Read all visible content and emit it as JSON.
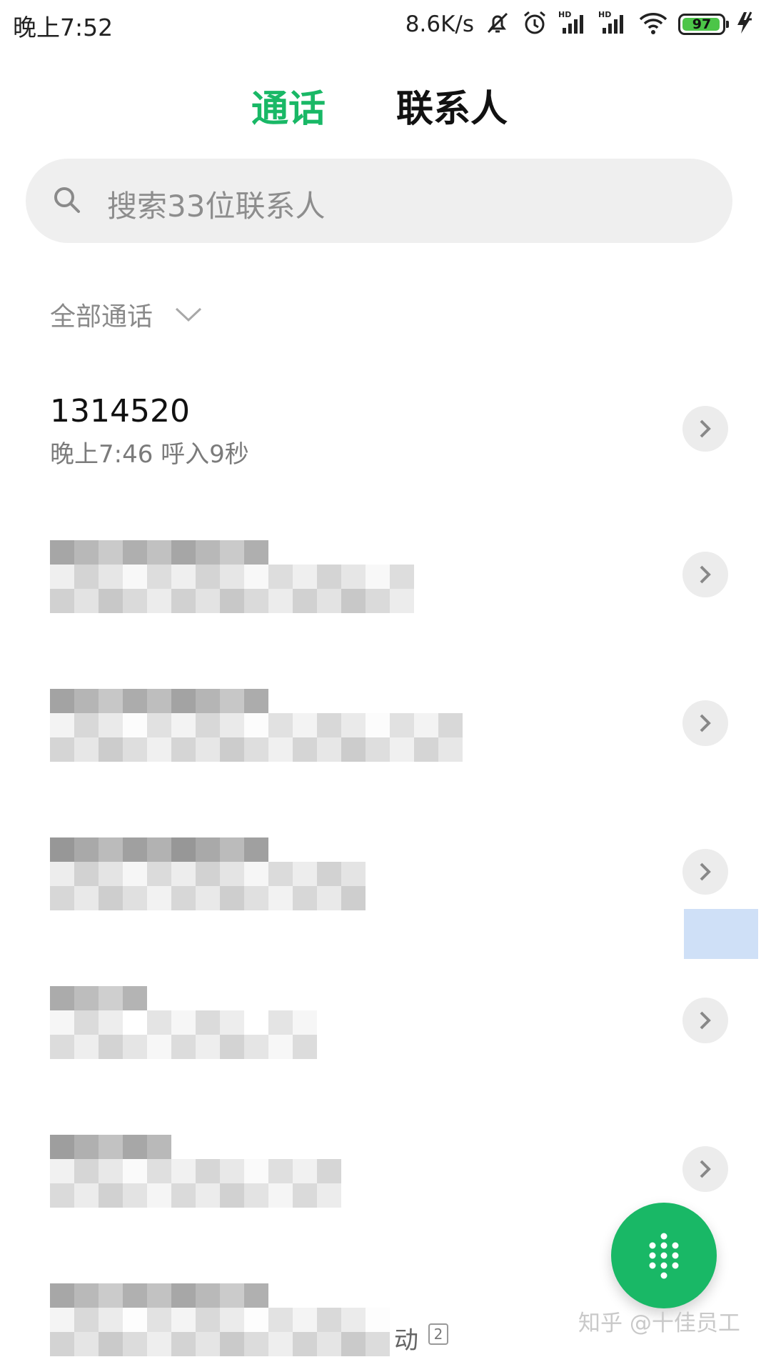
{
  "status_bar": {
    "time": "晚上7:52",
    "network_speed": "8.6K/s",
    "battery_level": "97",
    "icons": [
      "mute-icon",
      "alarm-icon",
      "hd-signal-icon",
      "hd-signal-icon",
      "wifi-icon",
      "battery-icon",
      "charging-icon"
    ]
  },
  "tabs": [
    {
      "label": "通话",
      "active": true
    },
    {
      "label": "联系人",
      "active": false
    }
  ],
  "search": {
    "placeholder": "搜索33位联系人"
  },
  "filter": {
    "label": "全部通话"
  },
  "calls": [
    {
      "number": "1314520",
      "detail": "晚上7:46 呼入9秒"
    }
  ],
  "partial_row_text": "动",
  "partial_row_badge": "2",
  "watermark": "知乎 @十佳员工",
  "colors": {
    "accent": "#19b866",
    "search_bg": "#efefef",
    "chevron_bg": "#ececec"
  }
}
